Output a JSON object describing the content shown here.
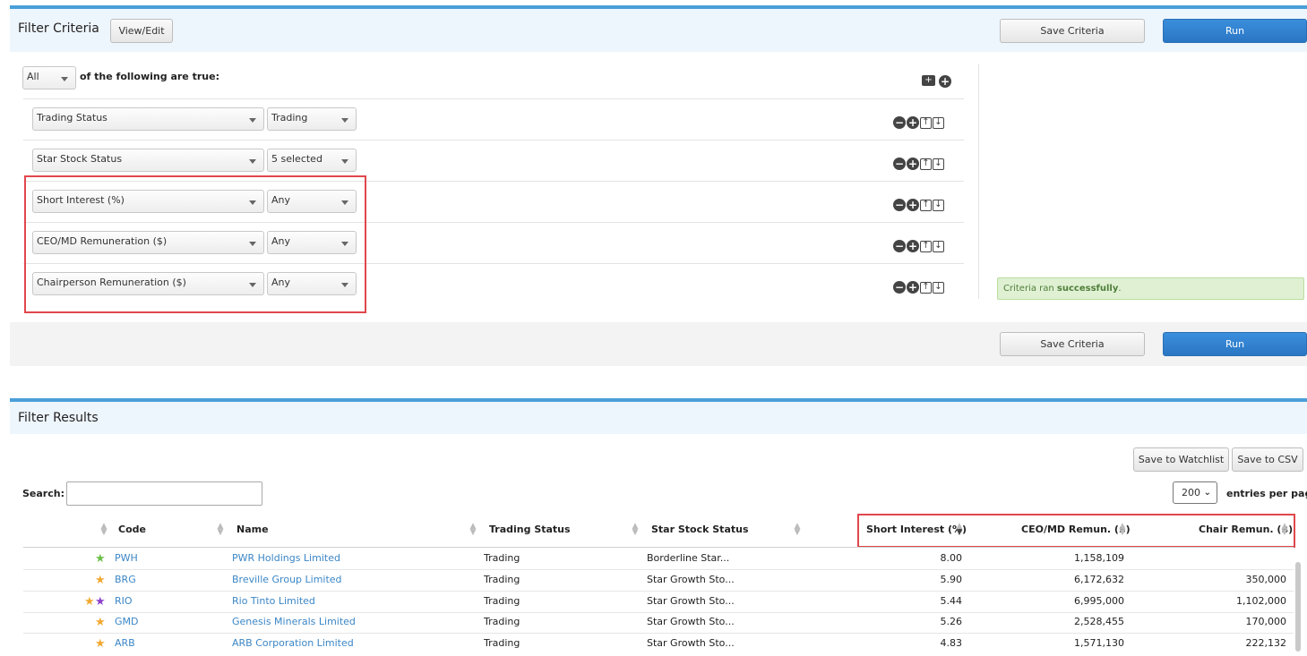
{
  "filter": {
    "title": "Filter Criteria",
    "view_edit": "View/Edit",
    "save_criteria": "Save Criteria",
    "run": "Run",
    "match_mode": "All",
    "match_text": "of the following are true:",
    "rows": [
      {
        "field": "Trading Status",
        "value": "Trading"
      },
      {
        "field": "Star Stock Status",
        "value": "5 selected"
      },
      {
        "field": "Short Interest (%)",
        "value": "Any"
      },
      {
        "field": "CEO/MD Remuneration ($)",
        "value": "Any"
      },
      {
        "field": "Chairperson Remuneration ($)",
        "value": "Any"
      }
    ],
    "success_prefix": "Criteria ran ",
    "success_word": "successfully",
    "success_suffix": "."
  },
  "results": {
    "title": "Filter Results",
    "save_watchlist": "Save to Watchlist",
    "save_csv": "Save to CSV",
    "search_label": "Search:",
    "search_value": "",
    "page_size": "200",
    "page_size_label": "entries per page",
    "columns": [
      "Code",
      "Name",
      "Trading Status",
      "Star Stock Status",
      "Short Interest (%)",
      "CEO/MD Remun. ($)",
      "Chair Remun. ($)"
    ],
    "rows": [
      {
        "stars": [
          "green"
        ],
        "code": "PWH",
        "name": "PWR Holdings Limited",
        "trading": "Trading",
        "star_status": "Borderline Star...",
        "short": "8.00",
        "ceo": "1,158,109",
        "chair": ""
      },
      {
        "stars": [
          "orange"
        ],
        "code": "BRG",
        "name": "Breville Group Limited",
        "trading": "Trading",
        "star_status": "Star Growth Sto...",
        "short": "5.90",
        "ceo": "6,172,632",
        "chair": "350,000"
      },
      {
        "stars": [
          "orange",
          "purple"
        ],
        "code": "RIO",
        "name": "Rio Tinto Limited",
        "trading": "Trading",
        "star_status": "Star Growth Sto...",
        "short": "5.44",
        "ceo": "6,995,000",
        "chair": "1,102,000"
      },
      {
        "stars": [
          "orange"
        ],
        "code": "GMD",
        "name": "Genesis Minerals Limited",
        "trading": "Trading",
        "star_status": "Star Growth Sto...",
        "short": "5.26",
        "ceo": "2,528,455",
        "chair": "170,000"
      },
      {
        "stars": [
          "orange"
        ],
        "code": "ARB",
        "name": "ARB Corporation Limited",
        "trading": "Trading",
        "star_status": "Star Growth Sto...",
        "short": "4.83",
        "ceo": "1,571,130",
        "chair": "222,132"
      }
    ]
  },
  "colors": {
    "accent": "#4a9fd8",
    "primary_button": "#2a76c4",
    "highlight": "#e0474c",
    "link": "#3b86c6",
    "star_green": "#6cc04a",
    "star_orange": "#f0a830",
    "star_purple": "#8a3fc9"
  }
}
